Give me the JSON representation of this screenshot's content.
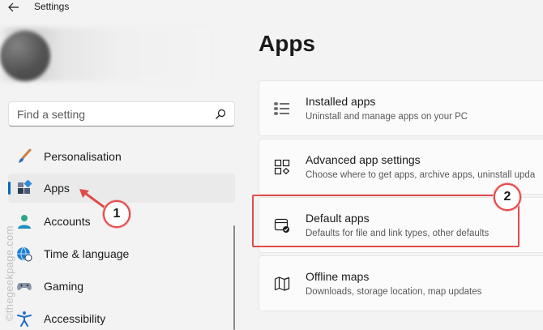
{
  "app": {
    "title": "Settings"
  },
  "search": {
    "placeholder": "Find a setting"
  },
  "sidebar": {
    "items": [
      {
        "label": "Personalisation",
        "icon": "paintbrush-icon"
      },
      {
        "label": "Apps",
        "icon": "apps-icon",
        "selected": true
      },
      {
        "label": "Accounts",
        "icon": "person-icon"
      },
      {
        "label": "Time & language",
        "icon": "globe-clock-icon"
      },
      {
        "label": "Gaming",
        "icon": "gamepad-icon"
      },
      {
        "label": "Accessibility",
        "icon": "accessibility-icon"
      }
    ]
  },
  "main": {
    "title": "Apps",
    "cards": [
      {
        "title": "Installed apps",
        "subtitle": "Uninstall and manage apps on your PC",
        "icon": "list-icon"
      },
      {
        "title": "Advanced app settings",
        "subtitle": "Choose where to get apps, archive apps, uninstall upda",
        "icon": "app-settings-icon"
      },
      {
        "title": "Default apps",
        "subtitle": "Defaults for file and link types, other defaults",
        "icon": "default-apps-icon"
      },
      {
        "title": "Offline maps",
        "subtitle": "Downloads, storage location, map updates",
        "icon": "map-icon"
      }
    ]
  },
  "annotations": {
    "step1": "1",
    "step2": "2",
    "watermark": "©thegeekpage.com",
    "color": "#e24a4a"
  },
  "colors": {
    "accent": "#0067c0",
    "background": "#f3f3f3",
    "card": "#fbfbfb"
  }
}
